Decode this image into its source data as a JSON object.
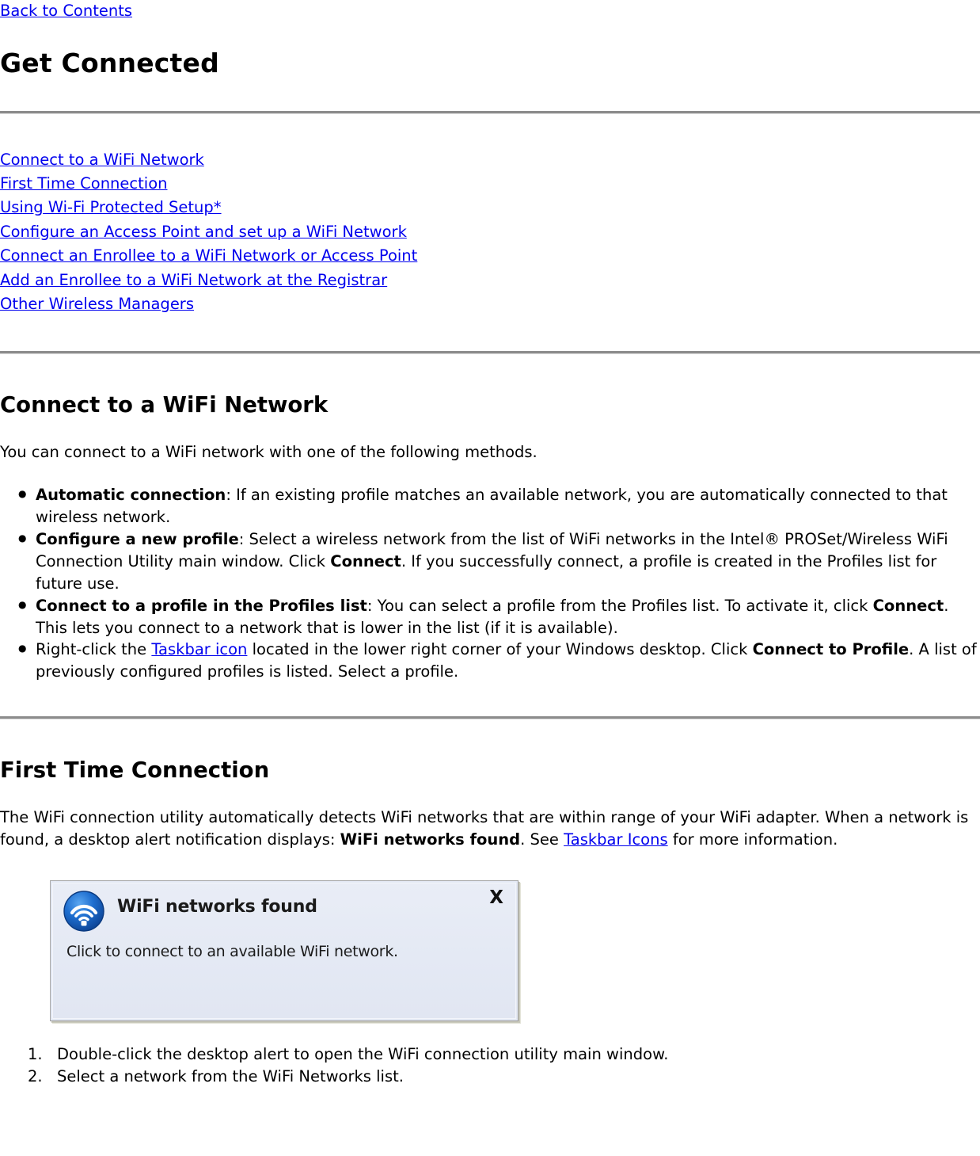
{
  "nav": {
    "back_to_contents": "Back to Contents"
  },
  "header": {
    "title": "Get Connected"
  },
  "toc": {
    "items": [
      "Connect to a WiFi Network",
      "First Time Connection",
      "Using Wi-Fi Protected Setup*",
      "Configure an Access Point and set up a WiFi Network ",
      "Connect an Enrollee to a WiFi Network or Access Point ",
      "Add an Enrollee to a WiFi Network at the Registrar",
      "Other Wireless Managers"
    ]
  },
  "connect_section": {
    "heading": "Connect to a WiFi Network",
    "intro": "You can connect to a WiFi network with one of the following methods.",
    "methods": [
      {
        "term": "Automatic connection",
        "colon": ": ",
        "text": "If an existing profile matches an available network, you are automatically connected to that wireless network."
      },
      {
        "term": "Configure a new profile",
        "colon": ": ",
        "text_1": "Select a wireless network from the list of WiFi networks in the Intel® PROSet/Wireless WiFi Connection Utility main window. Click ",
        "bold_inline": "Connect",
        "text_2": ". If you successfully connect, a profile is created in the Profiles list for future use."
      },
      {
        "term": "Connect to a profile in the Profiles list",
        "colon": ": ",
        "text_1": "You can select a profile from the Profiles list. To activate it, click ",
        "bold_inline": "Connect",
        "text_2": ". This lets you connect to a network that is lower in the list (if it is available)."
      },
      {
        "text_1": "Right-click the ",
        "link": "Taskbar icon",
        "text_2": " located in the lower right corner of your Windows desktop. Click ",
        "bold_inline": "Connect to Profile",
        "text_3": ". A list of previously configured profiles is listed. Select a profile."
      }
    ]
  },
  "first_time_section": {
    "heading": "First Time Connection",
    "paragraph_1": "The WiFi connection utility automatically detects WiFi networks that are within range of your WiFi adapter. When a network is found, a desktop alert notification displays: ",
    "bold_phrase": "WiFi networks found",
    "paragraph_2": ". See ",
    "link": "Taskbar Icons",
    "paragraph_3": " for more information.",
    "alert": {
      "icon": "wifi-signal-icon",
      "title": "WiFi networks found",
      "body": "Click to connect to an available WiFi network.",
      "close_label": "X",
      "background_color": "#e4e9f4",
      "border_color": "#9a9a9a",
      "icon_color": "#1464c8"
    },
    "steps": [
      "Double-click the desktop alert to open the WiFi connection utility main window.",
      "Select a network from the WiFi Networks list."
    ]
  }
}
